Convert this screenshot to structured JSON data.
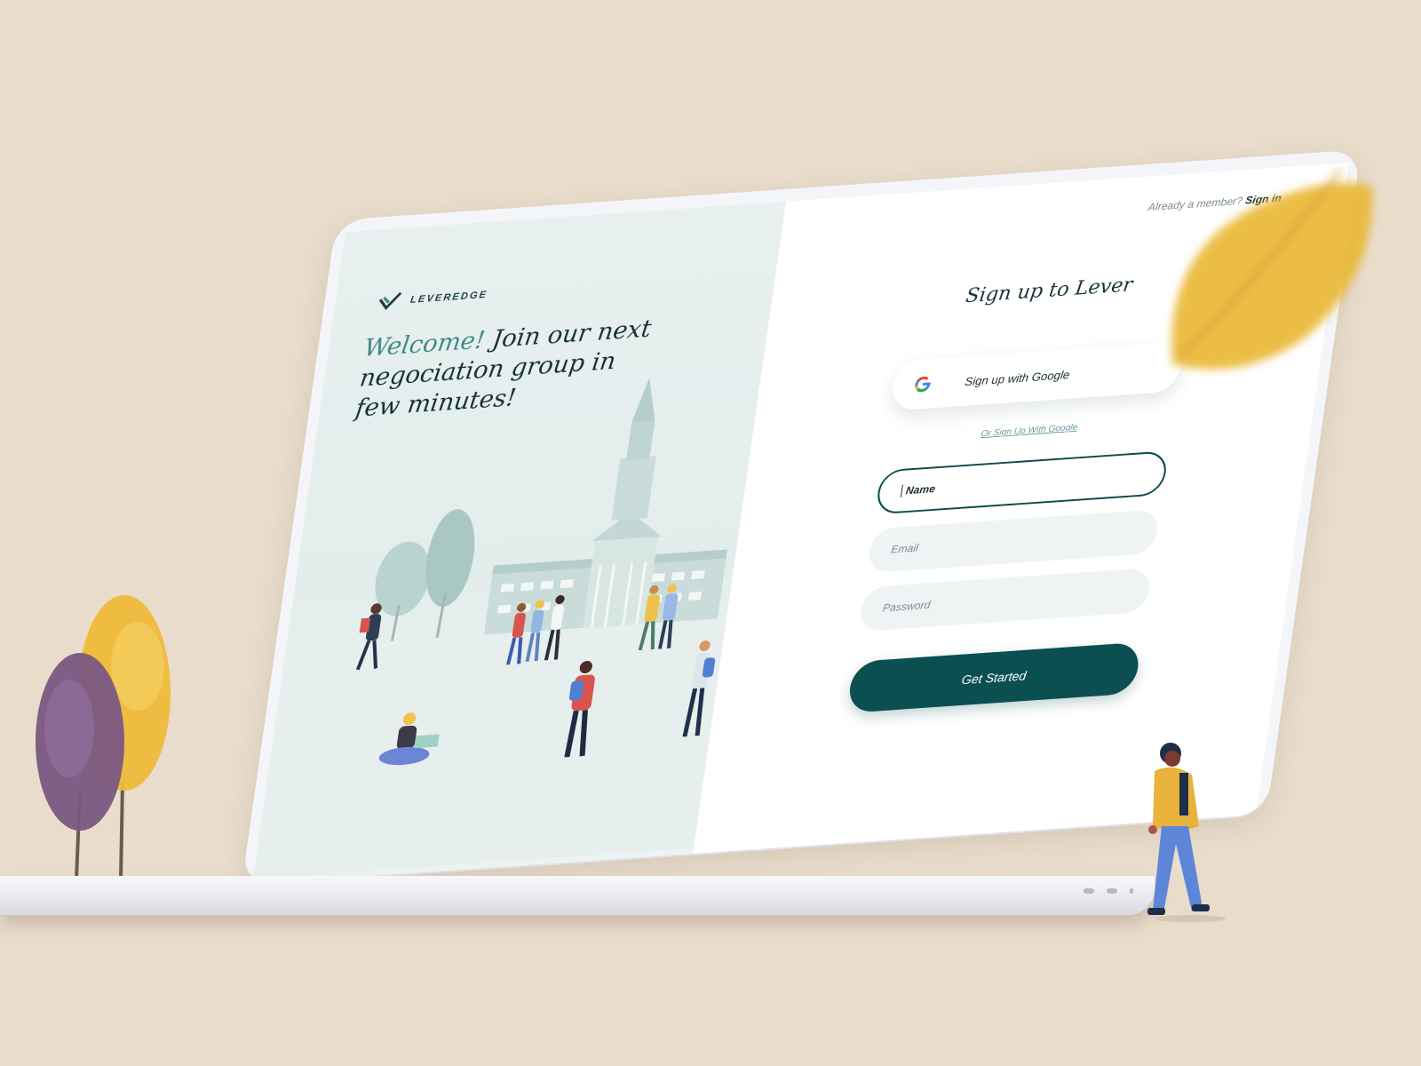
{
  "brand": {
    "name": "LEVEREDGE"
  },
  "hero": {
    "welcome": "Welcome!",
    "headline_rest": " Join our next negociation group in few minutes!"
  },
  "header": {
    "member_prompt": "Already a member?",
    "sign_in_label": "Sign in"
  },
  "signup": {
    "title": "Sign up to Lever",
    "google_button_label": "Sign up with Google",
    "alt_link": "Or Sign Up With Google",
    "name_value": "Name",
    "email_placeholder": "Email",
    "password_placeholder": "Password",
    "submit_label": "Get Started"
  },
  "colors": {
    "accent": "#0b4f51",
    "welcome": "#3e8a86",
    "background": "#e9dccb",
    "left_panel": "#e7f0ef",
    "field_bg": "#eef4f4"
  },
  "icons": {
    "google": "google-icon",
    "logo": "leveredge-logo-icon"
  }
}
